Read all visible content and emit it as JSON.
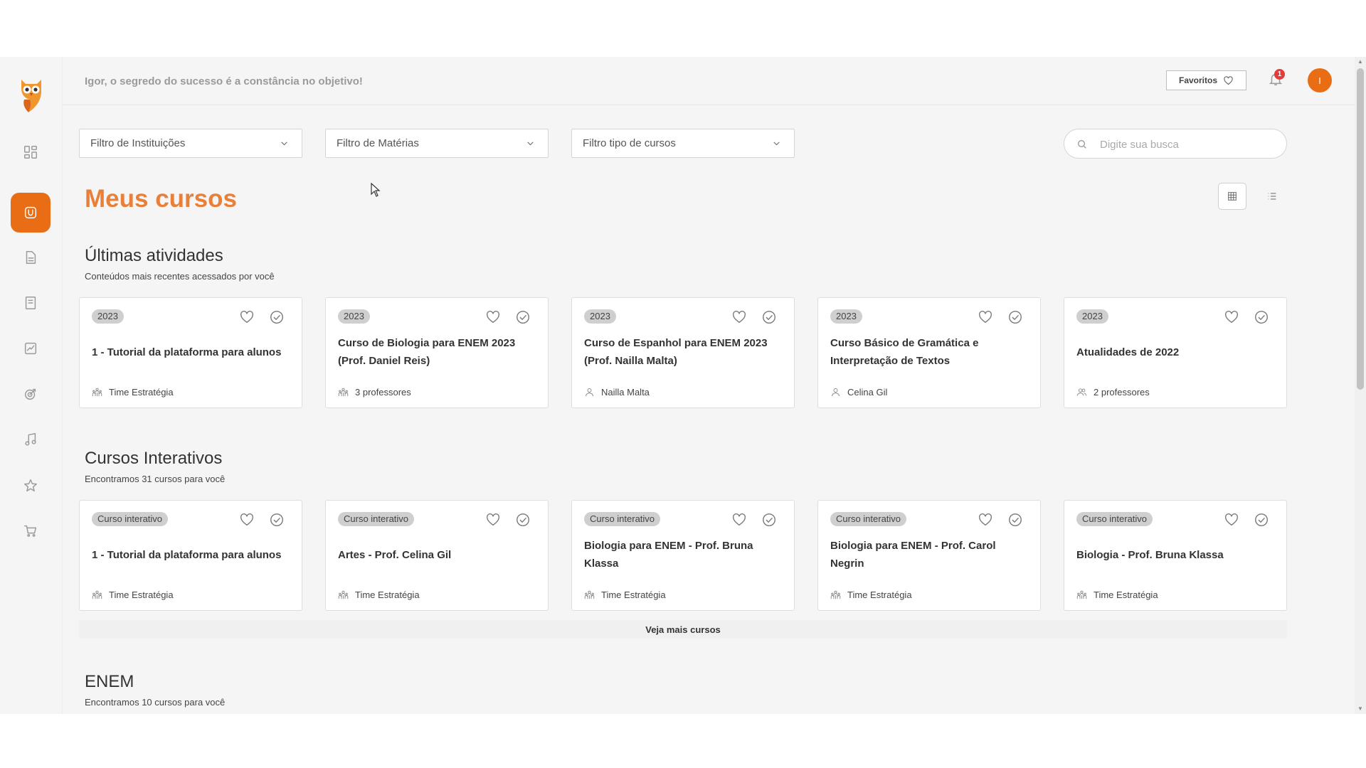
{
  "header": {
    "greeting": "Igor, o segredo do sucesso é a constância no objetivo!",
    "favorites_label": "Favoritos",
    "notification_count": "1",
    "avatar_initial": "I"
  },
  "sidebar": {
    "items": [
      {
        "icon": "dashboard-icon",
        "active": false
      },
      {
        "icon": "courses-icon",
        "active": true
      },
      {
        "icon": "document-icon",
        "active": false
      },
      {
        "icon": "notebook-icon",
        "active": false
      },
      {
        "icon": "chart-icon",
        "active": false
      },
      {
        "icon": "target-icon",
        "active": false
      },
      {
        "icon": "music-icon",
        "active": false
      },
      {
        "icon": "star-icon",
        "active": false
      },
      {
        "icon": "cart-icon",
        "active": false
      }
    ],
    "accent_color": "#e86d14"
  },
  "filters": {
    "institutions": "Filtro de Instituições",
    "subjects": "Filtro de Matérias",
    "course_type": "Filtro tipo de cursos",
    "search_placeholder": "Digite sua busca"
  },
  "page_title": "Meus cursos",
  "sections": {
    "recent": {
      "title": "Últimas atividades",
      "subtitle": "Conteúdos mais recentes acessados por você",
      "cards": [
        {
          "tag": "2023",
          "title": "1 - Tutorial da plataforma para alunos",
          "author": "Time Estratégia",
          "author_icon": "team-icon"
        },
        {
          "tag": "2023",
          "title": "Curso de Biologia para ENEM 2023 (Prof. Daniel Reis)",
          "author": "3 professores",
          "author_icon": "team-icon"
        },
        {
          "tag": "2023",
          "title": "Curso de Espanhol para ENEM 2023 (Prof. Nailla Malta)",
          "author": "Nailla Malta",
          "author_icon": "person-icon"
        },
        {
          "tag": "2023",
          "title": "Curso Básico de Gramática e Interpretação de Textos",
          "author": "Celina Gil",
          "author_icon": "person-icon"
        },
        {
          "tag": "2023",
          "title": "Atualidades de 2022",
          "author": "2 professores",
          "author_icon": "people-icon"
        }
      ]
    },
    "interactive": {
      "title": "Cursos Interativos",
      "subtitle": "Encontramos 31 cursos para você",
      "cards": [
        {
          "tag": "Curso interativo",
          "title": "1 - Tutorial da plataforma para alunos",
          "author": "Time Estratégia",
          "author_icon": "team-icon"
        },
        {
          "tag": "Curso interativo",
          "title": "Artes - Prof. Celina Gil",
          "author": "Time Estratégia",
          "author_icon": "team-icon"
        },
        {
          "tag": "Curso interativo",
          "title": "Biologia para ENEM - Prof. Bruna Klassa",
          "author": "Time Estratégia",
          "author_icon": "team-icon"
        },
        {
          "tag": "Curso interativo",
          "title": "Biologia para ENEM - Prof. Carol Negrin",
          "author": "Time Estratégia",
          "author_icon": "team-icon"
        },
        {
          "tag": "Curso interativo",
          "title": "Biologia - Prof. Bruna Klassa",
          "author": "Time Estratégia",
          "author_icon": "team-icon"
        }
      ],
      "more_label": "Veja mais cursos"
    },
    "enem": {
      "title": "ENEM",
      "subtitle": "Encontramos 10 cursos para você"
    }
  }
}
